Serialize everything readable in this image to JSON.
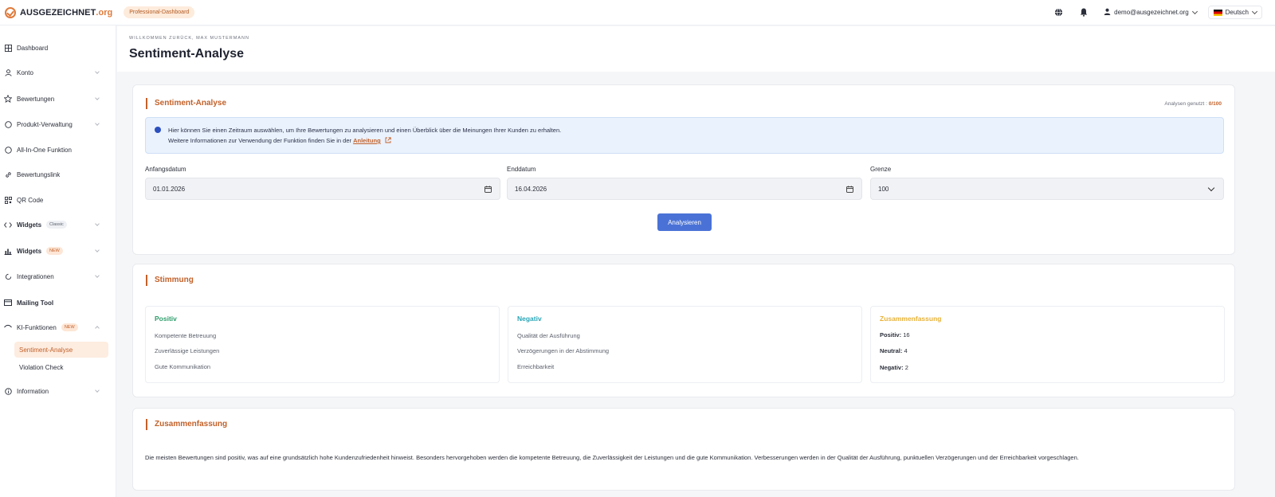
{
  "brand": {
    "name": "AUSGEZEICHNET",
    "ext": ".org",
    "color": "#e07a3a"
  },
  "topbar": {
    "plan_badge": "Professional-Dashboard",
    "icons": [
      "globe-icon",
      "bell-icon",
      "user-icon"
    ],
    "user_email": "demo@ausgezeichnet.org",
    "language": "Deutsch"
  },
  "sidebar": {
    "items": [
      {
        "label": "Dashboard",
        "icon": "grid-icon"
      },
      {
        "label": "Konto",
        "icon": "user-icon"
      },
      {
        "label": "Bewertungen",
        "icon": "star-icon"
      },
      {
        "label": "Produkt-Verwaltung",
        "icon": "box-icon"
      },
      {
        "label": "All-In-One Funktion",
        "icon": "circle-icon"
      },
      {
        "label": "Bewertungslink",
        "icon": "link-icon"
      },
      {
        "label": "QR Code",
        "icon": "qr-icon"
      },
      {
        "label": "Widgets",
        "icon": "code-icon",
        "badge": "Classic"
      },
      {
        "label": "Widgets",
        "icon": "chart-icon",
        "badge": "NEW"
      },
      {
        "label": "Integrationen",
        "icon": "plug-icon"
      },
      {
        "label": "Mailing Tool",
        "icon": "mail-icon"
      },
      {
        "label": "KI-Funktionen",
        "icon": "eye-icon",
        "badge": "NEW"
      },
      {
        "label": "Information",
        "icon": "info-icon"
      }
    ],
    "sub_items": [
      {
        "label": "Sentiment-Analyse",
        "active": true
      },
      {
        "label": "Violation Check",
        "active": false
      }
    ]
  },
  "header": {
    "welcome": "Willkommen zurück, Max Mustermann",
    "title": "Sentiment-Analyse"
  },
  "analysis_card": {
    "title": "Sentiment-Analyse",
    "quota_label": "Analysen genutzt :",
    "quota_value": "0/100",
    "info_line1": "Hier können Sie einen Zeitraum auswählen, um Ihre Bewertungen zu analysieren und einen Überblick über die Meinungen Ihrer Kunden zu erhalten.",
    "info_line2": "Weitere Informationen zur Verwendung der Funktion finden Sie in der",
    "info_link": "Anleitung",
    "start_label": "Anfangsdatum",
    "start_value": "01.01.2026",
    "end_label": "Enddatum",
    "end_value": "16.04.2026",
    "limit_label": "Grenze",
    "limit_value": "100",
    "button": "Analysieren"
  },
  "mood_card": {
    "title": "Stimmung",
    "positive": {
      "heading": "Positiv",
      "color": "#2e9e6b",
      "items": [
        "Kompetente Betreuung",
        "Zuverlässige Leistungen",
        "Gute Kommunikation"
      ]
    },
    "negative": {
      "heading": "Negativ",
      "color": "#2aa6b8",
      "items": [
        "Qualität der Ausführung",
        "Verzögerungen in der Abstimmung",
        "Erreichbarkeit"
      ]
    },
    "summary": {
      "heading": "Zusammenfassung",
      "color": "#e8b23a",
      "positive_label": "Positiv:",
      "positive_value": "16",
      "neutral_label": "Neutral:",
      "neutral_value": "4",
      "negative_label": "Negativ:",
      "negative_value": "2"
    }
  },
  "summary_card": {
    "title": "Zusammenfassung",
    "text": "Die meisten Bewertungen sind positiv, was auf eine grundsätzlich hohe Kundenzufriedenheit hinweist. Besonders hervorgehoben werden die kompetente Betreuung, die Zuverlässigkeit der Leistungen und die gute Kommunikation. Verbesserungen werden in der Qualität der Ausführung, punktuellen Verzögerungen und der Erreichbarkeit vorgeschlagen."
  }
}
